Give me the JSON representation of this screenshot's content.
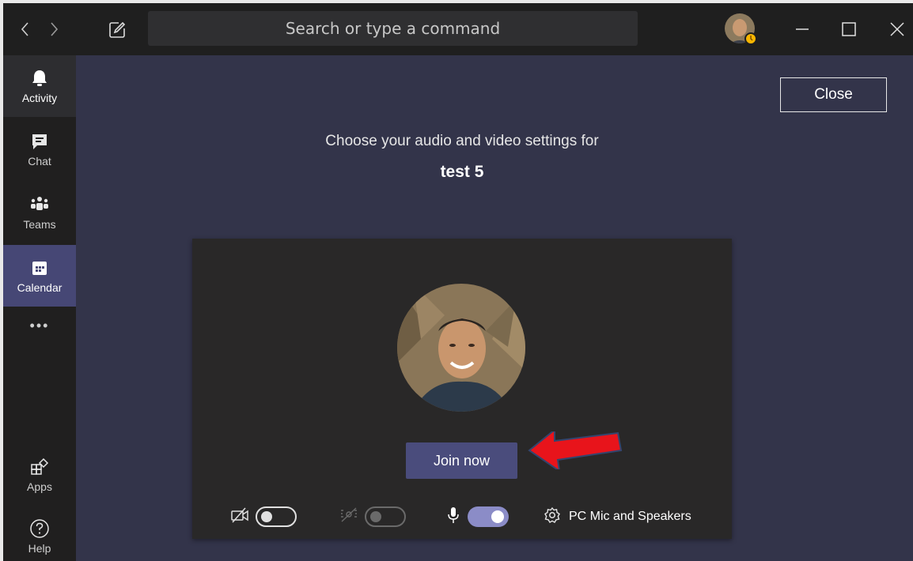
{
  "window": {
    "search_placeholder": "Search or type a command"
  },
  "rail": {
    "items": [
      {
        "label": "Activity",
        "icon": "bell-icon"
      },
      {
        "label": "Chat",
        "icon": "chat-icon"
      },
      {
        "label": "Teams",
        "icon": "teams-icon"
      },
      {
        "label": "Calendar",
        "icon": "calendar-icon"
      },
      {
        "label": "Apps",
        "icon": "apps-icon"
      },
      {
        "label": "Help",
        "icon": "help-icon"
      }
    ],
    "more_label": "•••"
  },
  "prejoin": {
    "close_label": "Close",
    "prompt": "Choose your audio and video settings for",
    "meeting_name": "test 5",
    "join_label": "Join now",
    "camera_on": false,
    "background_blur_on": false,
    "mic_on": true,
    "audio_device": "PC Mic and Speakers"
  },
  "colors": {
    "accent": "#464775",
    "join_button": "#4a4c7c",
    "toggle_on": "#8b8cc7",
    "annotation_arrow": "#e8141b",
    "status_away": "#f8b600"
  }
}
